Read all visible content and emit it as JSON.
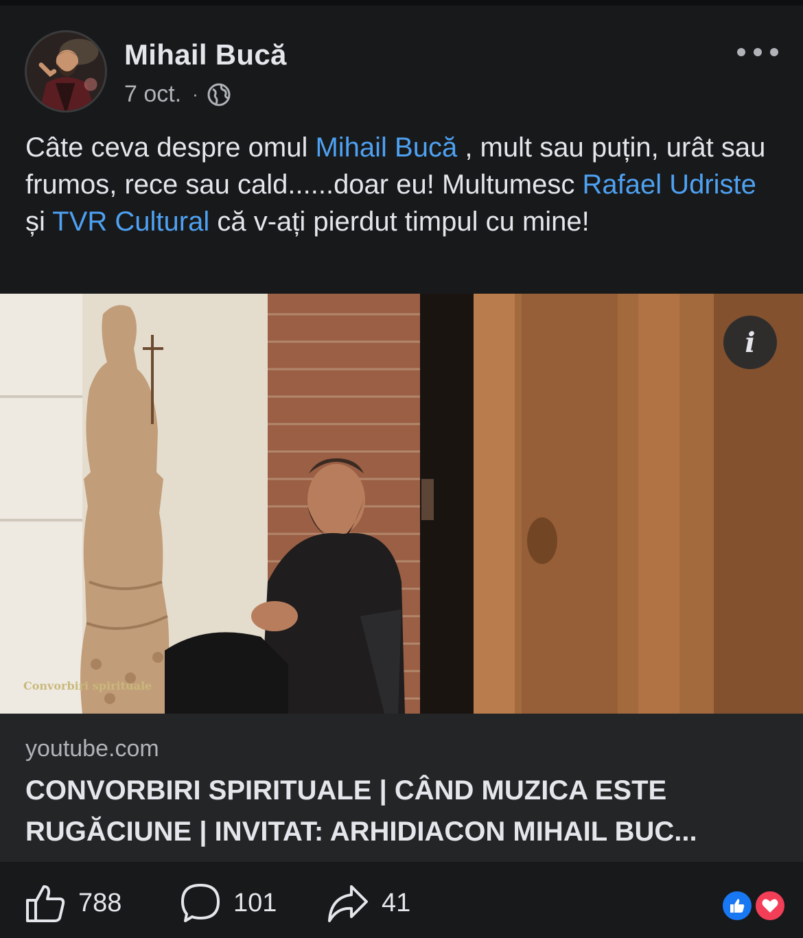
{
  "post": {
    "author": "Mihail Bucă",
    "date": "7 oct.",
    "separator": "·",
    "privacy_icon": "globe-icon",
    "more_icon": "more-horizontal-icon",
    "text": {
      "part1": "Câte ceva despre omul ",
      "mention1": "Mihail Bucă",
      "part2": " , mult sau  puțin, urât sau frumos, rece sau cald......doar eu! Multumesc ",
      "mention2": "Rafael Udriste",
      "part3": " și  ",
      "mention3": "TVR Cultural",
      "part4": " că  v-ați pierdut timpul cu mine!"
    }
  },
  "media": {
    "info_icon": "info-icon",
    "watermark": "Convorbiri\nspirituale"
  },
  "link": {
    "domain": "youtube.com",
    "title": "CONVORBIRI SPIRITUALE | CÂND MUZICA ESTE\nRUGĂCIUNE | INVITAT: ARHIDIACON MIHAIL BUC..."
  },
  "actions": {
    "likes": "788",
    "comments": "101",
    "shares": "41"
  },
  "reactions": [
    "like-reaction-icon",
    "love-reaction-icon"
  ],
  "colors": {
    "background": "#18191a",
    "card": "#242526",
    "mention": "#4ea1f3",
    "like_blue": "#1877f2",
    "love_red": "#f33e58"
  }
}
